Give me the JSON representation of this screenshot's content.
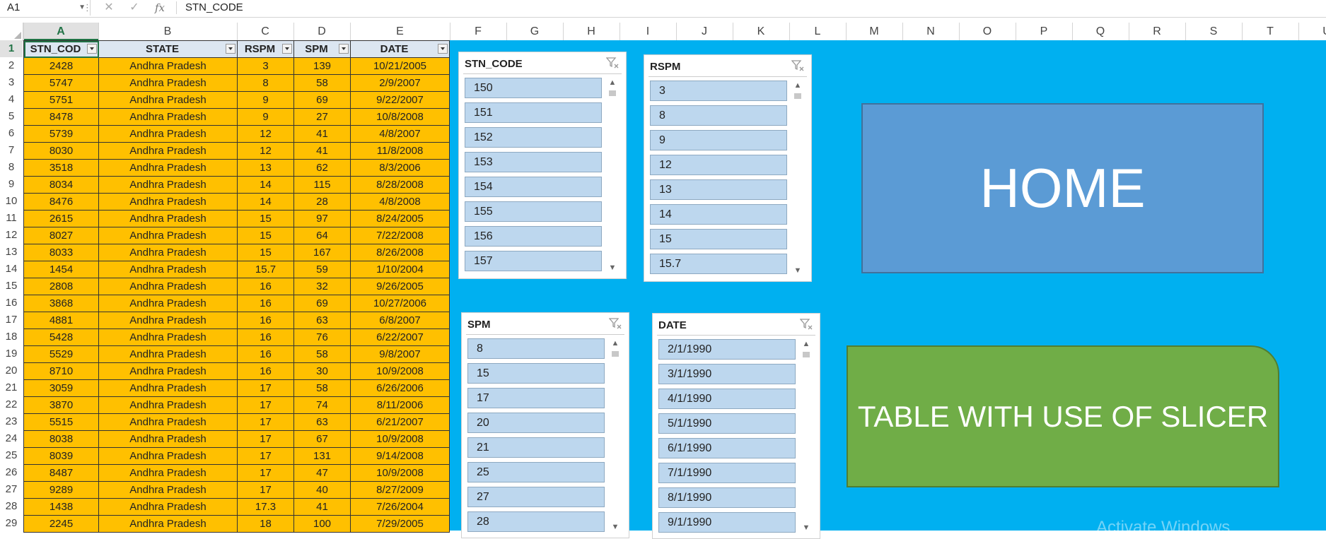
{
  "name_box": "A1",
  "formula_text": "STN_CODE",
  "columns": [
    "A",
    "B",
    "C",
    "D",
    "E",
    "F",
    "G",
    "H",
    "I",
    "J",
    "K",
    "L",
    "M",
    "N",
    "O",
    "P",
    "Q",
    "R",
    "S",
    "T",
    "U"
  ],
  "row_numbers": [
    "1",
    "2",
    "3",
    "4",
    "5",
    "6",
    "7",
    "8",
    "9",
    "10",
    "11",
    "12",
    "13",
    "14",
    "15",
    "16",
    "17",
    "18",
    "19",
    "20",
    "21",
    "22",
    "23",
    "24",
    "25",
    "26",
    "27",
    "28",
    "29"
  ],
  "table": {
    "headers": [
      "STN_COD",
      "STATE",
      "RSPM",
      "SPM",
      "DATE"
    ],
    "rows": [
      [
        "2428",
        "Andhra Pradesh",
        "3",
        "139",
        "10/21/2005"
      ],
      [
        "5747",
        "Andhra Pradesh",
        "8",
        "58",
        "2/9/2007"
      ],
      [
        "5751",
        "Andhra Pradesh",
        "9",
        "69",
        "9/22/2007"
      ],
      [
        "8478",
        "Andhra Pradesh",
        "9",
        "27",
        "10/8/2008"
      ],
      [
        "5739",
        "Andhra Pradesh",
        "12",
        "41",
        "4/8/2007"
      ],
      [
        "8030",
        "Andhra Pradesh",
        "12",
        "41",
        "11/8/2008"
      ],
      [
        "3518",
        "Andhra Pradesh",
        "13",
        "62",
        "8/3/2006"
      ],
      [
        "8034",
        "Andhra Pradesh",
        "14",
        "115",
        "8/28/2008"
      ],
      [
        "8476",
        "Andhra Pradesh",
        "14",
        "28",
        "4/8/2008"
      ],
      [
        "2615",
        "Andhra Pradesh",
        "15",
        "97",
        "8/24/2005"
      ],
      [
        "8027",
        "Andhra Pradesh",
        "15",
        "64",
        "7/22/2008"
      ],
      [
        "8033",
        "Andhra Pradesh",
        "15",
        "167",
        "8/26/2008"
      ],
      [
        "1454",
        "Andhra Pradesh",
        "15.7",
        "59",
        "1/10/2004"
      ],
      [
        "2808",
        "Andhra Pradesh",
        "16",
        "32",
        "9/26/2005"
      ],
      [
        "3868",
        "Andhra Pradesh",
        "16",
        "69",
        "10/27/2006"
      ],
      [
        "4881",
        "Andhra Pradesh",
        "16",
        "63",
        "6/8/2007"
      ],
      [
        "5428",
        "Andhra Pradesh",
        "16",
        "76",
        "6/22/2007"
      ],
      [
        "5529",
        "Andhra Pradesh",
        "16",
        "58",
        "9/8/2007"
      ],
      [
        "8710",
        "Andhra Pradesh",
        "16",
        "30",
        "10/9/2008"
      ],
      [
        "3059",
        "Andhra Pradesh",
        "17",
        "58",
        "6/26/2006"
      ],
      [
        "3870",
        "Andhra Pradesh",
        "17",
        "74",
        "8/11/2006"
      ],
      [
        "5515",
        "Andhra Pradesh",
        "17",
        "63",
        "6/21/2007"
      ],
      [
        "8038",
        "Andhra Pradesh",
        "17",
        "67",
        "10/9/2008"
      ],
      [
        "8039",
        "Andhra Pradesh",
        "17",
        "131",
        "9/14/2008"
      ],
      [
        "8487",
        "Andhra Pradesh",
        "17",
        "47",
        "10/9/2008"
      ],
      [
        "9289",
        "Andhra Pradesh",
        "17",
        "40",
        "8/27/2009"
      ],
      [
        "1438",
        "Andhra Pradesh",
        "17.3",
        "41",
        "7/26/2004"
      ],
      [
        "2245",
        "Andhra Pradesh",
        "18",
        "100",
        "7/29/2005"
      ]
    ]
  },
  "slicers": [
    {
      "title": "STN_CODE",
      "items": [
        "150",
        "151",
        "152",
        "153",
        "154",
        "155",
        "156",
        "157"
      ]
    },
    {
      "title": "RSPM",
      "items": [
        "3",
        "8",
        "9",
        "12",
        "13",
        "14",
        "15",
        "15.7"
      ]
    },
    {
      "title": "SPM",
      "items": [
        "8",
        "15",
        "17",
        "20",
        "21",
        "25",
        "27",
        "28"
      ]
    },
    {
      "title": "DATE",
      "items": [
        "2/1/1990",
        "3/1/1990",
        "4/1/1990",
        "5/1/1990",
        "6/1/1990",
        "7/1/1990",
        "8/1/1990",
        "9/1/1990"
      ]
    }
  ],
  "home_label": "HOME",
  "slicer_table_label": "TABLE WITH USE OF SLICER",
  "watermark": "Activate Windows",
  "colors": {
    "table_fill": "#ffc000",
    "header_fill": "#dce6f1",
    "background": "#00b0f0",
    "home_fill": "#5b9bd5",
    "slicer_btn_fill": "#70ad47",
    "slicer_item": "#bdd7ee"
  }
}
